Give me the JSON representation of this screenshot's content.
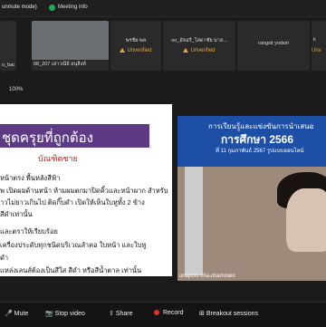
{
  "topbar": {
    "unmute_mode": "unmute mode)",
    "meeting_info": "Meeting info"
  },
  "participants": [
    {
      "name": "o_bac",
      "status": ""
    },
    {
      "name": "08_207 เสาวณีย์ อนุสิงห์",
      "status": ""
    },
    {
      "name": "พรชัย-พล",
      "status": "Unverified"
    },
    {
      "name": "oo_อัจฉรี_โสดาชัย มาล...",
      "status": "Unverified"
    },
    {
      "name": "rangsit yodsiri",
      "status": ""
    },
    {
      "name": "k",
      "status": "Unv"
    }
  ],
  "toolbar2": {
    "zoom": "100%"
  },
  "slide": {
    "title": "ชุดครุยที่ถูกต้อง",
    "subhead": "บัณฑิตชาย",
    "lines": [
      "หน้าตรง พื้นหลังสีฟ้า",
      "พ เปิดผมด้านหน้า ห้ามผมตกมาปิดคิ้วและหน้าผาก สำหรับ",
      "าวไม่ยาวเกินไป ติดกิ๊บดำ เปิดให้เห็นใบหูทั้ง 2 ข้าง",
      "สีดำเท่านั้น",
      "และตราให้เรียบร้อย",
      "เครื่องประดับทุกชนิดบริเวณลำคอ ใบหน้า และใบหู",
      "ดำ",
      "แหล่งเลนส์ต้องเป็นสีใส สีดำ หรือสีน้ำตาล เท่านั้น"
    ]
  },
  "video": {
    "banner_line1": "การเรียนรู้และแข่งขันการนำเสนอ",
    "banner_title": "การศึกษา 2566",
    "banner_line3": "ที่ 11 กุมภาพันธ์ 2567 รูปแบบออนไลน์",
    "name": "unapom cha-chamroen"
  },
  "bottom": {
    "mute": "Mute",
    "stop_video": "Stop video",
    "share": "Share",
    "record": "Record",
    "breakout": "Breakout sessions"
  }
}
